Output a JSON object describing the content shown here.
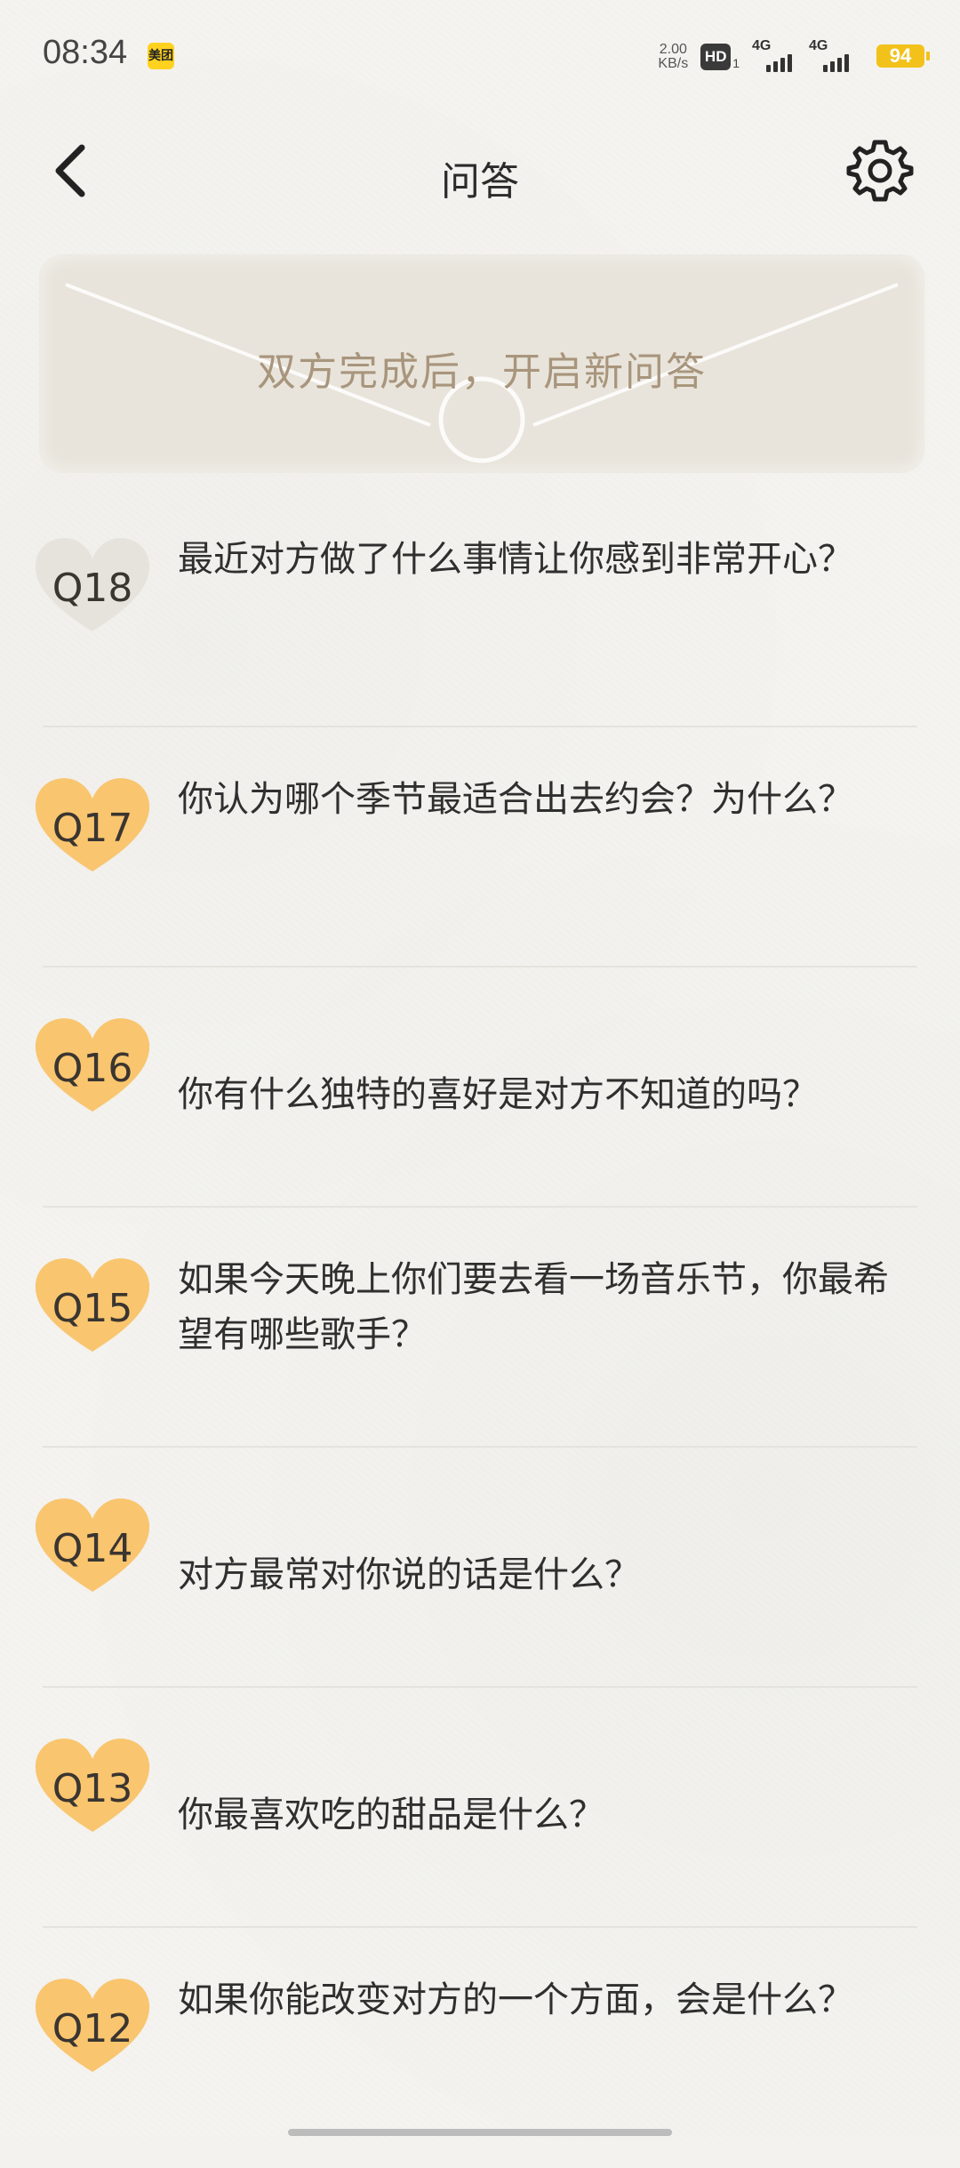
{
  "status_bar": {
    "time": "08:34",
    "app_badge": "美团",
    "net_speed_value": "2.00",
    "net_speed_unit": "KB/s",
    "hd_label": "HD",
    "hd_sub": "1",
    "sim1_label": "4G",
    "sim2_label": "4G",
    "battery": "94"
  },
  "nav": {
    "title": "问答",
    "back_icon": "chevron-left-icon",
    "settings_icon": "gear-icon"
  },
  "banner": {
    "text": "双方完成后，开启新问答",
    "icon": "envelope-icon"
  },
  "questions": [
    {
      "number": "Q18",
      "text": "最近对方做了什么事情让你感到非常开心？",
      "status": "pending",
      "color": "#e6e3dd"
    },
    {
      "number": "Q17",
      "text": "你认为哪个季节最适合出去约会？为什么？",
      "status": "done",
      "color": "#f9c56f"
    },
    {
      "number": "Q16",
      "text": "你有什么独特的喜好是对方不知道的吗？",
      "status": "done",
      "color": "#f9c56f"
    },
    {
      "number": "Q15",
      "text": "如果今天晚上你们要去看一场音乐节，你最希望有哪些歌手？",
      "status": "done",
      "color": "#f9c56f"
    },
    {
      "number": "Q14",
      "text": "对方最常对你说的话是什么？",
      "status": "done",
      "color": "#f9c56f"
    },
    {
      "number": "Q13",
      "text": "你最喜欢吃的甜品是什么？",
      "status": "done",
      "color": "#f9c56f"
    },
    {
      "number": "Q12",
      "text": "如果你能改变对方的一个方面，会是什么？",
      "status": "done",
      "color": "#f9c56f"
    }
  ],
  "colors": {
    "background": "#f3f2ee",
    "banner": "#e8e4db",
    "banner_text": "#a8957c",
    "heart_done": "#f9c56f",
    "heart_pending": "#e6e3dd",
    "battery": "#f3c21a"
  }
}
